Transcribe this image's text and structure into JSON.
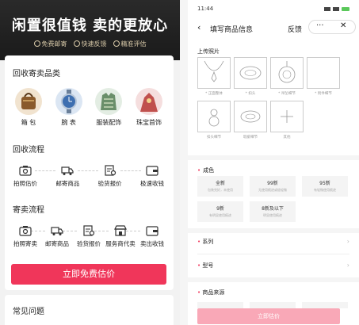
{
  "left": {
    "banner": {
      "title": "闲置很值钱  卖的更放心",
      "tags": [
        "免费邮寄",
        "快速反馈",
        "精准评估"
      ]
    },
    "categories_title": "回收寄卖品类",
    "categories": [
      {
        "label": "箱 包",
        "icon": "handbag-icon",
        "color": "#8a5a2b"
      },
      {
        "label": "腕 表",
        "icon": "watch-icon",
        "color": "#3e6fb0"
      },
      {
        "label": "服装配饰",
        "icon": "sweater-icon",
        "color": "#6a8f6a"
      },
      {
        "label": "珠宝首饰",
        "icon": "jewelry-icon",
        "color": "#c0504d"
      }
    ],
    "recycle_flow_title": "回收流程",
    "recycle_steps": [
      {
        "label": "拍照估价",
        "icon": "camera-icon"
      },
      {
        "label": "邮寄商品",
        "icon": "truck-icon"
      },
      {
        "label": "验货报价",
        "icon": "inspect-icon"
      },
      {
        "label": "极速收钱",
        "icon": "wallet-icon"
      }
    ],
    "consign_flow_title": "寄卖流程",
    "consign_steps": [
      {
        "label": "拍照寄卖",
        "icon": "camera-icon"
      },
      {
        "label": "邮寄商品",
        "icon": "truck-icon"
      },
      {
        "label": "验货报价",
        "icon": "inspect-icon"
      },
      {
        "label": "服务商代卖",
        "icon": "shop-icon"
      },
      {
        "label": "卖出收钱",
        "icon": "wallet-icon"
      }
    ],
    "cta_label": "立即免费估价",
    "faq_title": "常见问题"
  },
  "right": {
    "status_time": "11:44",
    "nav": {
      "back": "‹",
      "title": "填写商品信息",
      "feedback": "反馈",
      "more": "···",
      "close": "✕"
    },
    "upload_title": "上传照片",
    "photos": [
      {
        "label": "* 正面整体",
        "icon": "necklace-front-icon"
      },
      {
        "label": "* 扣头",
        "icon": "clasp-logo-icon"
      },
      {
        "label": "* 吊坠细节",
        "icon": "pendant-icon"
      },
      {
        "label": "* 附件细节",
        "icon": "blank-photo-icon"
      },
      {
        "label": "扣头细节",
        "icon": "clasp-detail-icon"
      },
      {
        "label": "瑕疵细节",
        "icon": "logo-tag-icon"
      },
      {
        "label": "其他",
        "icon": "plus-icon"
      }
    ],
    "condition_title": "成色",
    "conditions": [
      {
        "name": "全新",
        "desc": "包装完好，未使用"
      },
      {
        "name": "99新",
        "desc": "无使用痕迹或极轻微"
      },
      {
        "name": "95新",
        "desc": "有轻微使用痕迹"
      },
      {
        "name": "9新",
        "desc": "有明显使用痕迹"
      },
      {
        "name": "8新及以下",
        "desc": "明显使用痕迹"
      }
    ],
    "rows": [
      "系列",
      "型号",
      "商品来源"
    ],
    "submit_label": "立即估价"
  }
}
